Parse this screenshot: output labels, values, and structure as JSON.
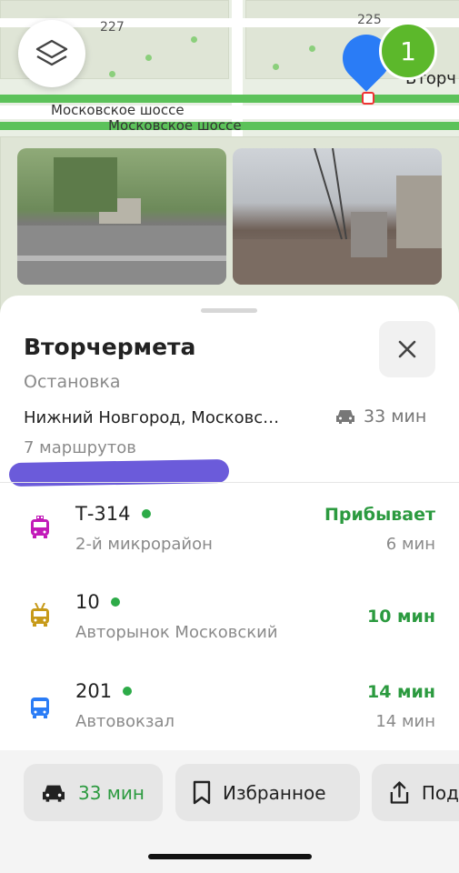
{
  "map": {
    "house_numbers": [
      "227",
      "225"
    ],
    "road_labels": [
      "Московское шоссе",
      "Московское шоссе"
    ],
    "stop_label_partial": "Вторч",
    "stop_count_badge": "1",
    "icons": {
      "layers": "layers-icon",
      "pin": "location-pin-icon"
    }
  },
  "sheet": {
    "title": "Вторчермета",
    "subtitle": "Остановка",
    "address": "Нижний Новгород, Московс…",
    "drive_time": "33 мин",
    "routes_count": "7 маршрутов"
  },
  "routes": [
    {
      "number": "Т-314",
      "destination": "2-й микрорайон",
      "status": "Прибывает",
      "next": "6 мин",
      "icon": "taxi-bus-icon",
      "color": "#c21ab8"
    },
    {
      "number": "10",
      "destination": "Авторынок Московский",
      "status": "10 мин",
      "next": "",
      "icon": "trolleybus-icon",
      "color": "#c79a19"
    },
    {
      "number": "201",
      "destination": "Автовокзал",
      "status": "14 мин",
      "next": "14 мин",
      "icon": "bus-icon",
      "color": "#2a7cf6"
    }
  ],
  "actions": {
    "drive": "33 мин",
    "favorite": "Избранное",
    "share": "Под"
  },
  "colors": {
    "accent_green": "#2b9a3f",
    "pin_blue": "#2a7cf6",
    "badge_green": "#5cb82b"
  }
}
